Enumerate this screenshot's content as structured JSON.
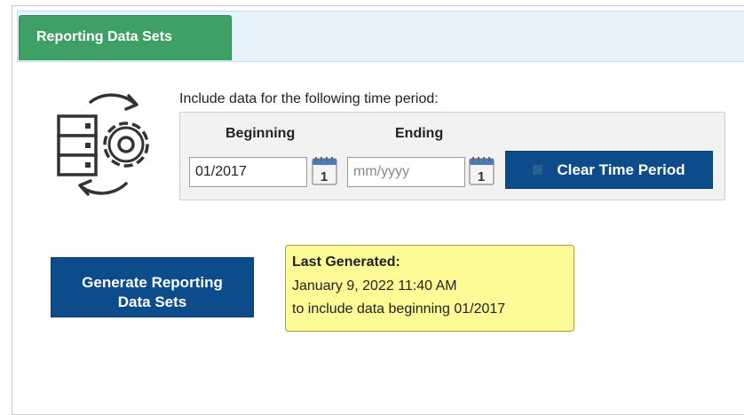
{
  "tab": {
    "label": "Reporting Data Sets"
  },
  "time_period": {
    "prompt": "Include data for the following time period:",
    "beginning_label": "Beginning",
    "ending_label": "Ending",
    "beginning_value": "01/2017",
    "ending_value": "",
    "ending_placeholder": "mm/yyyy",
    "calendar_day": "1",
    "clear_button_label": "Clear Time Period"
  },
  "generate_button": {
    "line1": "Generate Reporting",
    "line2": "Data Sets"
  },
  "last_generated": {
    "title": "Last Generated:",
    "datetime": "January 9, 2022 11:40 AM",
    "detail": "to include data beginning 01/2017"
  },
  "icons": {
    "data_sync": "data-sync-icon",
    "calendar": "calendar-icon",
    "clear": "clear-x-icon"
  },
  "colors": {
    "tab_green": "#3fa066",
    "button_blue": "#0d4c8a",
    "tab_bar_bg": "#e6f2fc",
    "note_yellow": "#fdfb96",
    "period_box_bg": "#f2f2f2"
  }
}
